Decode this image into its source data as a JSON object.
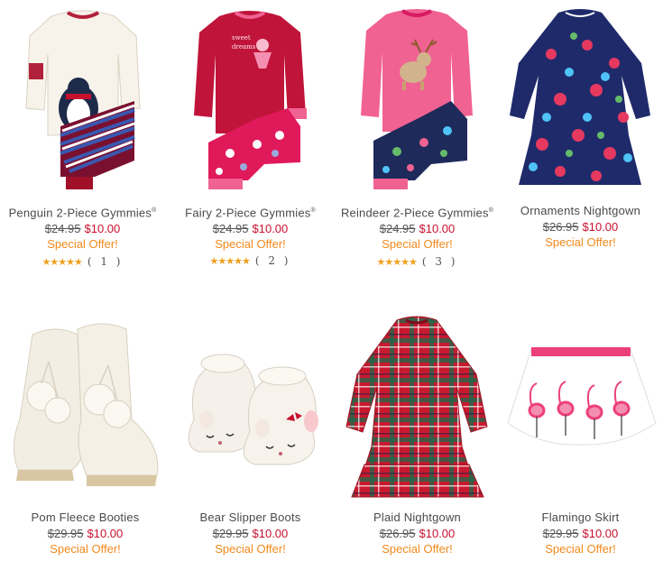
{
  "products": [
    {
      "name": "Penguin 2-Piece Gymmies",
      "mark": "®",
      "was": "$24.95",
      "now": "$10.00",
      "offer": "Special Offer!",
      "stars": "★★★★★",
      "count": "( 1 )",
      "image": "penguin-pajamas-image"
    },
    {
      "name": "Fairy 2-Piece Gymmies",
      "mark": "®",
      "was": "$24.95",
      "now": "$10.00",
      "offer": "Special Offer!",
      "stars": "★★★★★",
      "count": "( 2 )",
      "image": "fairy-pajamas-image"
    },
    {
      "name": "Reindeer 2-Piece Gymmies",
      "mark": "®",
      "was": "$24.95",
      "now": "$10.00",
      "offer": "Special Offer!",
      "stars": "★★★★★",
      "count": "( 3 )",
      "image": "reindeer-pajamas-image"
    },
    {
      "name": "Ornaments Nightgown",
      "was": "$26.95",
      "now": "$10.00",
      "offer": "Special Offer!",
      "image": "ornaments-nightgown-image"
    },
    {
      "name": "Pom Fleece Booties",
      "was": "$29.95",
      "now": "$10.00",
      "offer": "Special Offer!",
      "image": "pom-booties-image"
    },
    {
      "name": "Bear Slipper Boots",
      "was": "$29.95",
      "now": "$10.00",
      "offer": "Special Offer!",
      "image": "bear-slippers-image"
    },
    {
      "name": "Plaid Nightgown",
      "was": "$26.95",
      "now": "$10.00",
      "offer": "Special Offer!",
      "image": "plaid-nightgown-image"
    },
    {
      "name": "Flamingo Skirt",
      "was": "$29.95",
      "now": "$10.00",
      "offer": "Special Offer!",
      "image": "flamingo-skirt-image"
    }
  ]
}
